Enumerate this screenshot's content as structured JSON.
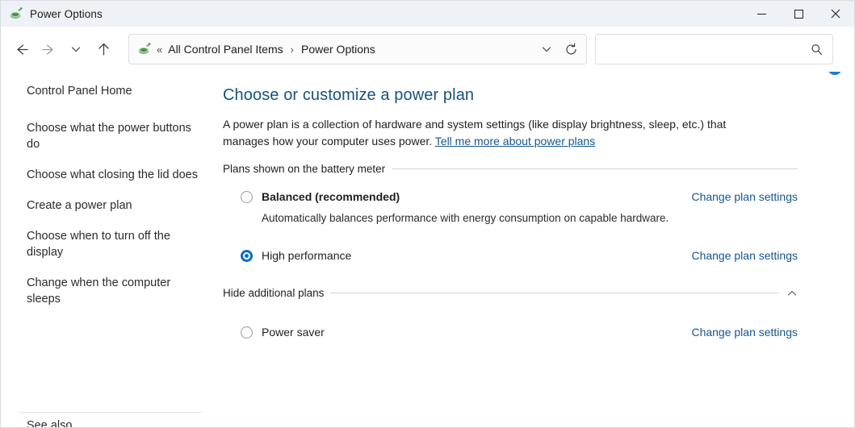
{
  "window": {
    "title": "Power Options",
    "app_icon": "power-plug-icon",
    "caption": {
      "minimize": "minimize-icon",
      "maximize": "maximize-icon",
      "close": "close-icon"
    }
  },
  "toolbar": {
    "back": "back-arrow-icon",
    "forward": "forward-arrow-icon",
    "recent": "chevron-down-icon",
    "up": "up-arrow-icon",
    "address": {
      "icon": "control-panel-icon",
      "prefix": "«",
      "crumbs": [
        "All Control Panel Items",
        "Power Options"
      ],
      "separator": "›",
      "dropdown": "chevron-down-icon",
      "refresh": "refresh-icon"
    },
    "search": {
      "value": "",
      "placeholder": "",
      "icon": "search-icon"
    }
  },
  "sidebar": {
    "home": "Control Panel Home",
    "items": [
      {
        "label": "Choose what the power buttons do",
        "icon": null
      },
      {
        "label": "Choose what closing the lid does",
        "icon": null
      },
      {
        "label": "Create a power plan",
        "icon": null
      },
      {
        "label": "Choose when to turn off the display",
        "icon": "clock-icon"
      },
      {
        "label": "Change when the computer sleeps",
        "icon": "moon-icon"
      }
    ],
    "see_also": "See also"
  },
  "content": {
    "help_icon": "help-icon",
    "title": "Choose or customize a power plan",
    "description_before": "A power plan is a collection of hardware and system settings (like display brightness, sleep, etc.) that manages how your computer uses power. ",
    "description_link": "Tell me more about power plans",
    "groups": [
      {
        "label": "Plans shown on the battery meter",
        "collapse_icon": null,
        "plans": [
          {
            "name": "Balanced (recommended)",
            "bold": true,
            "selected": false,
            "description": "Automatically balances performance with energy consumption on capable hardware.",
            "change_link": "Change plan settings"
          },
          {
            "name": "High performance",
            "bold": false,
            "selected": true,
            "description": "",
            "change_link": "Change plan settings"
          }
        ]
      },
      {
        "label": "Hide additional plans",
        "collapse_icon": "chevron-up-icon",
        "plans": [
          {
            "name": "Power saver",
            "bold": false,
            "selected": false,
            "description": "",
            "change_link": "Change plan settings"
          }
        ]
      }
    ]
  },
  "colors": {
    "accent": "#0b6ec4",
    "link": "#14568f",
    "title": "#16537d",
    "titlebar_bg": "#eef1f5"
  }
}
